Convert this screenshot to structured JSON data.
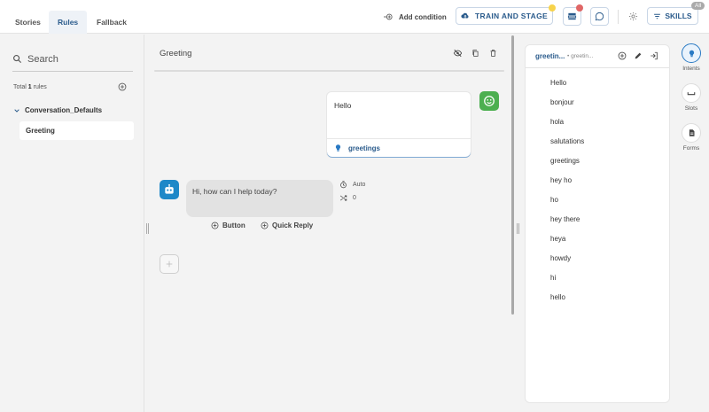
{
  "tabs": [
    {
      "label": "Stories"
    },
    {
      "label": "Rules"
    },
    {
      "label": "Fallback"
    }
  ],
  "header": {
    "train_label": "TRAIN AND STAGE",
    "skills_label": "SKILLS",
    "all_badge": "All"
  },
  "sidebar": {
    "search_placeholder": "Search",
    "total_prefix": "Total",
    "total_count": "1",
    "total_suffix": "rules",
    "group_name": "Conversation_Defaults",
    "rule_name": "Greeting"
  },
  "editor": {
    "title": "Greeting",
    "add_condition": "Add condition",
    "user_message": "Hello",
    "intent": "greetings",
    "bot_message": "Hi, how can I help today?",
    "timing": "Auto",
    "shuffle_count": "0",
    "button_label": "Button",
    "quick_reply_label": "Quick Reply"
  },
  "intent_panel": {
    "title": "greetin...",
    "subtitle": "greetin...",
    "examples": [
      "Hello",
      "bonjour",
      "hola",
      "salutations",
      "greetings",
      "hey ho",
      "ho",
      "hey there",
      "heya",
      "howdy",
      "hi",
      "hello"
    ]
  },
  "right_sidebar": [
    {
      "label": "Intents"
    },
    {
      "label": "Slots"
    },
    {
      "label": "Forms"
    }
  ],
  "colors": {
    "accent": "#2a5b8c",
    "bot_avatar": "#1e88c8",
    "user_avatar": "#4caf50",
    "dot_yellow": "#f7d34b",
    "dot_red": "#e06666"
  }
}
